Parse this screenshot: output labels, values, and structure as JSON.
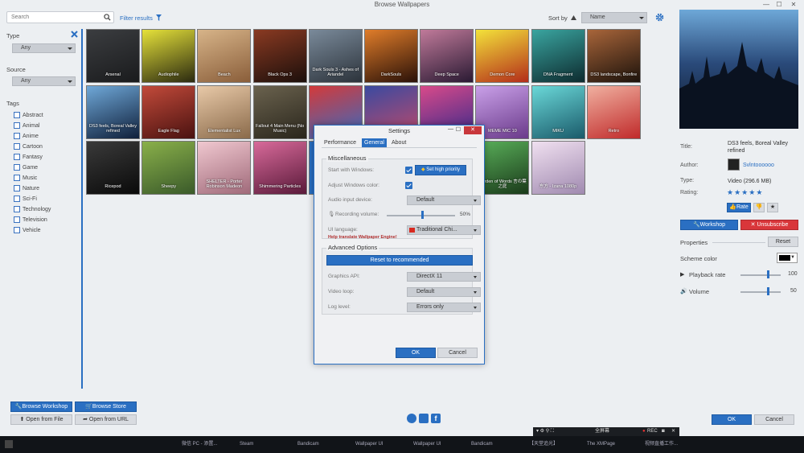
{
  "window": {
    "title": "Browse Wallpapers"
  },
  "search": {
    "placeholder": "Search"
  },
  "filter": {
    "label": "Filter results"
  },
  "sort": {
    "label": "Sort by",
    "value": "Name"
  },
  "sidebar": {
    "type_label": "Type",
    "type_value": "Any",
    "source_label": "Source",
    "source_value": "Any",
    "tags_label": "Tags",
    "tags": [
      "Abstract",
      "Animal",
      "Anime",
      "Cartoon",
      "Fantasy",
      "Game",
      "Music",
      "Nature",
      "Sci-Fi",
      "Technology",
      "Television",
      "Vehicle"
    ]
  },
  "wallpapers": [
    {
      "name": "Arsenal",
      "c1": "#3b3d40",
      "c2": "#1a1b1d"
    },
    {
      "name": "Audiophile",
      "c1": "#e6e23a",
      "c2": "#2b2a10"
    },
    {
      "name": "Beach",
      "c1": "#d7b489",
      "c2": "#8a5e3a"
    },
    {
      "name": "Black Ops 3",
      "c1": "#8a3a22",
      "c2": "#1c0f0b"
    },
    {
      "name": "Dark Souls 3 - Ashes of Ariandel",
      "c1": "#7a8a9a",
      "c2": "#2c333b"
    },
    {
      "name": "DarkSouls",
      "c1": "#e07d2a",
      "c2": "#2a1108"
    },
    {
      "name": "Deep Space",
      "c1": "#c07a9a",
      "c2": "#2a1a33"
    },
    {
      "name": "Demon Core",
      "c1": "#f3e23a",
      "c2": "#b32d1a"
    },
    {
      "name": "DNA Fragment",
      "c1": "#3aa5a0",
      "c2": "#0d2b2f"
    },
    {
      "name": "DS3 landscape, Bonfire",
      "c1": "#a8653a",
      "c2": "#1c120b"
    },
    {
      "name": "DS3 feels, Boreal Valley refined",
      "c1": "#6fa8d8",
      "c2": "#0f1f3a"
    },
    {
      "name": "Eagle Flag",
      "c1": "#c24a3a",
      "c2": "#4a1210"
    },
    {
      "name": "Elementalist Lux",
      "c1": "#e8c9a8",
      "c2": "#8a6a4a"
    },
    {
      "name": "Fallout 4 Main Menu (No Music)",
      "c1": "#6a624e",
      "c2": "#2a261c"
    },
    {
      "name": "",
      "c1": "#d33a3a",
      "c2": "#3a6ac0"
    },
    {
      "name": "",
      "c1": "#3a4aa0",
      "c2": "#c04a6a"
    },
    {
      "name": "",
      "c1": "#d84a8a",
      "c2": "#3a2a8a"
    },
    {
      "name": "MEME MIC 10",
      "c1": "#c9a0e8",
      "c2": "#6a3a8a"
    },
    {
      "name": "MIKU",
      "c1": "#6ad8d8",
      "c2": "#1a5a6a"
    },
    {
      "name": "Retro",
      "c1": "#f0b0a0",
      "c2": "#c02a2a"
    },
    {
      "name": "Ricepod",
      "c1": "#3a3a3a",
      "c2": "#0a0a0a"
    },
    {
      "name": "Sheepy",
      "c1": "#8ab04a",
      "c2": "#3a5a2a"
    },
    {
      "name": "SHELTER - Porter Robinson Madeon",
      "c1": "#f0c8d0",
      "c2": "#a06a7a"
    },
    {
      "name": "Shimmering Particles",
      "c1": "#d86a9a",
      "c2": "#5a1a3a"
    },
    {
      "name": "",
      "c1": "#2a6fc2",
      "c2": "#2a6fc2"
    },
    {
      "name": "",
      "c1": "#2a6fc2",
      "c2": "#2a6fc2"
    },
    {
      "name": "",
      "c1": "#3a3a3a",
      "c2": "#1a1a1a"
    },
    {
      "name": "Garden of Words 言の葉之庭",
      "c1": "#5ab05a",
      "c2": "#1a3a1a"
    },
    {
      "name": "东方 - Izana 1080p",
      "c1": "#f0e0f0",
      "c2": "#a08ab0"
    }
  ],
  "buttons": {
    "browse_workshop": "Browse Workshop",
    "browse_store": "Browse Store",
    "open_file": "Open from File",
    "open_url": "Open from URL",
    "ok": "OK",
    "cancel": "Cancel"
  },
  "preview": {
    "title_key": "Title:",
    "title_val": "DS3 feels, Boreal Valley refined",
    "author_key": "Author:",
    "author_val": "Svlntoooooo",
    "type_key": "Type:",
    "type_val": "Video (296.6 MB)",
    "rating_key": "Rating:",
    "rating": 5,
    "rate_btn": "Rate",
    "workshop_btn": "Workshop",
    "unsubscribe_btn": "Unsubscribe",
    "properties_label": "Properties",
    "reset_btn": "Reset",
    "scheme_label": "Scheme color",
    "scheme_color": "#000000",
    "playback_label": "Playback rate",
    "playback_val": "100",
    "playback_frac": 0.65,
    "volume_label": "Volume",
    "volume_val": "50",
    "volume_frac": 0.65
  },
  "settings": {
    "title": "Settings",
    "tabs": [
      "Performance",
      "General",
      "About"
    ],
    "active_tab": 1,
    "misc_title": "Miscellaneous",
    "start_label": "Start with Windows:",
    "high_priority": "Set high priority",
    "adjust_label": "Adjust Windows color:",
    "audio_label": "Audio input device:",
    "audio_val": "Default",
    "recvol_label": "Recording volume:",
    "recvol_val": "50%",
    "recvol_frac": 0.5,
    "lang_label": "UI language:",
    "lang_val": "Traditional Chi...",
    "help_translate": "Help translate Wallpaper Engine!",
    "adv_title": "Advanced Options",
    "reset_btn": "Reset to recommended",
    "gapi_label": "Graphics API:",
    "gapi_val": "DirectX 11",
    "loop_label": "Video loop:",
    "loop_val": "Default",
    "log_label": "Log level:",
    "log_val": "Errors only",
    "ok": "OK",
    "cancel": "Cancel"
  },
  "recorder": {
    "label": "全屏幕",
    "rec": "REC"
  },
  "taskbar": [
    "微信 PC - 添置...",
    "Steam",
    "Bandicam",
    "Wallpaper UI",
    "Wallpaper UI",
    "Bandicam",
    "【天堂追光】",
    "The XMPage",
    "视频直播工作..."
  ]
}
